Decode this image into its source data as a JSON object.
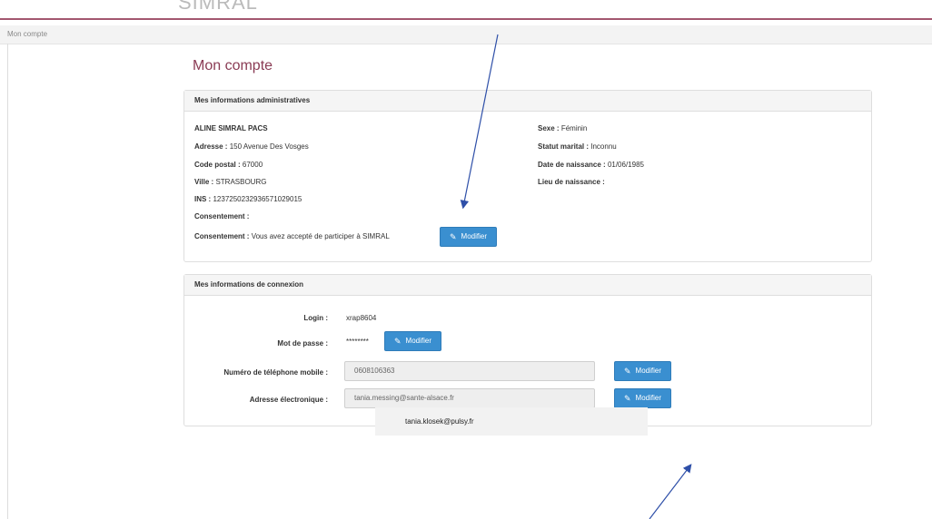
{
  "header": {
    "brand": "SIMRAL"
  },
  "breadcrumb": {
    "current": "Mon compte"
  },
  "page": {
    "title": "Mon compte"
  },
  "admin_panel": {
    "title": "Mes informations administratives",
    "name": "ALINE SIMRAL PACS",
    "address_label": "Adresse :",
    "address_value": "150 Avenue Des Vosges",
    "postal_label": "Code postal :",
    "postal_value": "67000",
    "city_label": "Ville :",
    "city_value": "STRASBOURG",
    "ins_label": "INS :",
    "ins_value": "1237250232936571029015",
    "consent_label": "Consentement :",
    "consent_label_2": "Consentement :",
    "consent_value": "Vous avez accepté de participer à SIMRAL",
    "consent_button": "Modifier",
    "sex_label": "Sexe :",
    "sex_value": "Féminin",
    "marital_label": "Statut marital :",
    "marital_value": "Inconnu",
    "birthdate_label": "Date de naissance :",
    "birthdate_value": "01/06/1985",
    "birthplace_label": "Lieu de naissance :"
  },
  "login_panel": {
    "title": "Mes informations de connexion",
    "login_label": "Login :",
    "login_value": "xrap8604",
    "password_label": "Mot de passe :",
    "password_value": "********",
    "password_button": "Modifier",
    "phone_label": "Numéro de téléphone mobile :",
    "phone_value": "0608106363",
    "phone_button": "Modifier",
    "email_label": "Adresse électronique :",
    "email_value": "tania.messing@sante-alsace.fr",
    "email_button": "Modifier"
  },
  "annotation": {
    "note": "tania.klosek@pulsy.fr"
  },
  "colors": {
    "accent": "#8a3b54",
    "button": "#3a8fd0",
    "arrow": "#2e4fa8"
  }
}
